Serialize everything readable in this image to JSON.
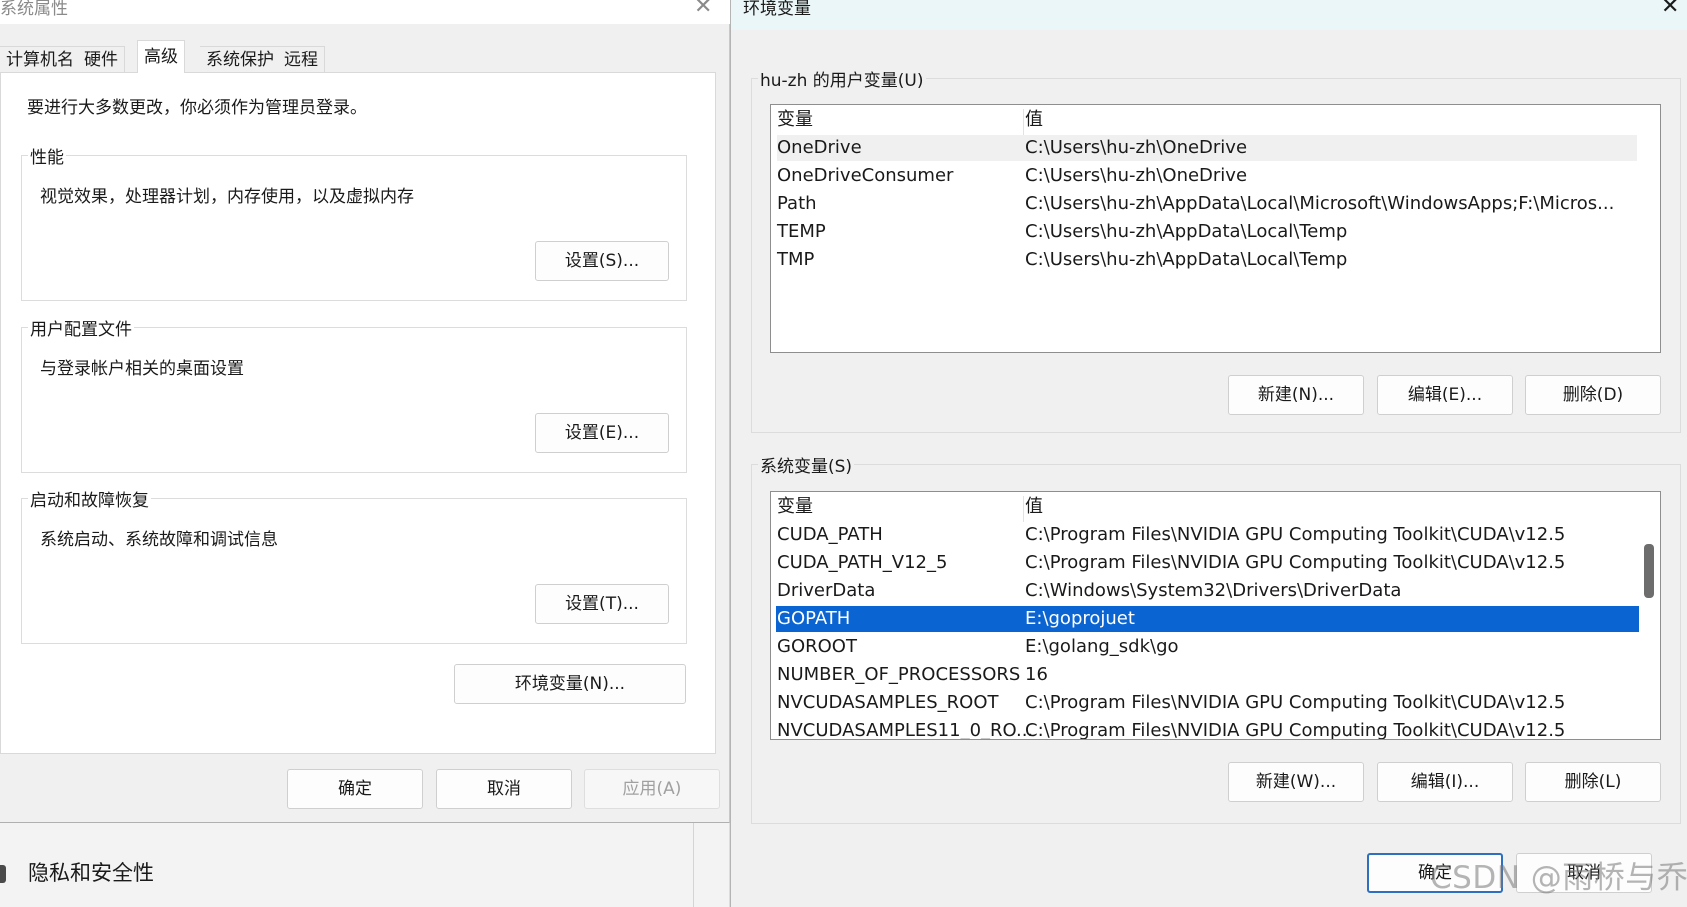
{
  "sysprops": {
    "title": "系统属性",
    "close_glyph": "✕",
    "tabs": [
      "计算机名",
      "硬件",
      "高级",
      "系统保护",
      "远程"
    ],
    "admin_note": "要进行大多数更改，你必须作为管理员登录。",
    "groups": [
      {
        "legend": "性能",
        "description": "视觉效果，处理器计划，内存使用，以及虚拟内存",
        "button": "设置(S)..."
      },
      {
        "legend": "用户配置文件",
        "description": "与登录帐户相关的桌面设置",
        "button": "设置(E)..."
      },
      {
        "legend": "启动和故障恢复",
        "description": "系统启动、系统故障和调试信息",
        "button": "设置(T)..."
      }
    ],
    "env_button": "环境变量(N)...",
    "ok": "确定",
    "cancel": "取消",
    "apply": "应用(A)"
  },
  "background": {
    "privacy_label": "隐私和安全性",
    "privacy_icon": "shield-icon"
  },
  "envvars": {
    "title": "环境变量",
    "close_glyph": "✕",
    "user_group": {
      "legend": "hu-zh 的用户变量(U)",
      "header": {
        "name": "变量",
        "value": "值"
      },
      "rows": [
        {
          "name": "OneDrive",
          "value": "C:\\Users\\hu-zh\\OneDrive"
        },
        {
          "name": "OneDriveConsumer",
          "value": "C:\\Users\\hu-zh\\OneDrive"
        },
        {
          "name": "Path",
          "value": "C:\\Users\\hu-zh\\AppData\\Local\\Microsoft\\WindowsApps;F:\\Micros..."
        },
        {
          "name": "TEMP",
          "value": "C:\\Users\\hu-zh\\AppData\\Local\\Temp"
        },
        {
          "name": "TMP",
          "value": "C:\\Users\\hu-zh\\AppData\\Local\\Temp"
        }
      ],
      "new_button": "新建(N)...",
      "edit_button": "编辑(E)...",
      "delete_button": "删除(D)"
    },
    "system_group": {
      "legend": "系统变量(S)",
      "header": {
        "name": "变量",
        "value": "值"
      },
      "rows": [
        {
          "name": "CUDA_PATH",
          "value": "C:\\Program Files\\NVIDIA GPU Computing Toolkit\\CUDA\\v12.5"
        },
        {
          "name": "CUDA_PATH_V12_5",
          "value": "C:\\Program Files\\NVIDIA GPU Computing Toolkit\\CUDA\\v12.5"
        },
        {
          "name": "DriverData",
          "value": "C:\\Windows\\System32\\Drivers\\DriverData"
        },
        {
          "name": "GOPATH",
          "value": "E:\\goprojuet"
        },
        {
          "name": "GOROOT",
          "value": "E:\\golang_sdk\\go"
        },
        {
          "name": "NUMBER_OF_PROCESSORS",
          "value": "16"
        },
        {
          "name": "NVCUDASAMPLES_ROOT",
          "value": "C:\\Program Files\\NVIDIA GPU Computing Toolkit\\CUDA\\v12.5"
        },
        {
          "name": "NVCUDASAMPLES11_0_RO...",
          "value": "C:\\Program Files\\NVIDIA GPU Computing Toolkit\\CUDA\\v12.5"
        }
      ],
      "selected_row": "GOPATH",
      "new_button": "新建(W)...",
      "edit_button": "编辑(I)...",
      "delete_button": "删除(L)"
    },
    "ok": "确定",
    "cancel": "取消"
  },
  "watermark": "CSDN @雨桥与乔",
  "colors": {
    "selection": "#0a64d1",
    "titlebar_env": "#eaf6f7",
    "primary_border": "#2f6fc0"
  }
}
